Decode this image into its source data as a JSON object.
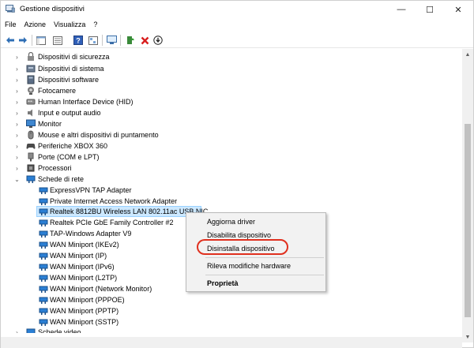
{
  "window": {
    "title": "Gestione dispositivi",
    "minimize_glyph": "—",
    "maximize_glyph": "☐",
    "close_glyph": "✕"
  },
  "menu": [
    "File",
    "Azione",
    "Visualizza",
    "?"
  ],
  "toolbar": {
    "icons": [
      "back-icon",
      "forward-icon",
      "show-hide-tree-icon",
      "properties-icon",
      "help-icon",
      "expand-icon",
      "monitor-scan-icon",
      "update-driver-icon",
      "uninstall-icon",
      "download-icon"
    ]
  },
  "tree": {
    "categories_before": [
      {
        "label": "Dispositivi di sicurezza",
        "icon": "security-icon"
      },
      {
        "label": "Dispositivi di sistema",
        "icon": "system-icon"
      },
      {
        "label": "Dispositivi software",
        "icon": "software-icon"
      },
      {
        "label": "Fotocamere",
        "icon": "camera-icon"
      },
      {
        "label": "Human Interface Device (HID)",
        "icon": "hid-icon"
      },
      {
        "label": "Input e output audio",
        "icon": "audio-icon"
      },
      {
        "label": "Monitor",
        "icon": "monitor-icon"
      },
      {
        "label": "Mouse e altri dispositivi di puntamento",
        "icon": "mouse-icon"
      },
      {
        "label": "Periferiche XBOX 360",
        "icon": "gamepad-icon"
      },
      {
        "label": "Porte (COM e LPT)",
        "icon": "port-icon"
      },
      {
        "label": "Processori",
        "icon": "cpu-icon"
      }
    ],
    "network_category": {
      "label": "Schede di rete",
      "icon": "network-icon"
    },
    "network_children": [
      "ExpressVPN TAP Adapter",
      "Private Internet Access Network Adapter",
      "Realtek 8812BU Wireless LAN 802.11ac USB NIC",
      "Realtek PCIe GbE Family Controller #2",
      "TAP-Windows Adapter V9",
      "WAN Miniport (IKEv2)",
      "WAN Miniport (IP)",
      "WAN Miniport (IPv6)",
      "WAN Miniport (L2TP)",
      "WAN Miniport (Network Monitor)",
      "WAN Miniport (PPPOE)",
      "WAN Miniport (PPTP)",
      "WAN Miniport (SSTP)"
    ],
    "selected": "Realtek 8812BU Wireless LAN 802.11ac USB NIC",
    "category_after": {
      "label": "Schede video",
      "icon": "display-adapter-icon"
    }
  },
  "context_menu": {
    "items": [
      {
        "label": "Aggiorna driver",
        "bold": false
      },
      {
        "label": "Disabilita dispositivo",
        "bold": false
      },
      {
        "label": "Disinstalla dispositivo",
        "bold": false,
        "highlighted": true
      },
      {
        "label": "Rileva modifiche hardware",
        "bold": false
      },
      {
        "label": "Proprietà",
        "bold": true
      }
    ]
  },
  "colors": {
    "selection_bg": "#cce8ff",
    "highlight_ring": "#e0301e",
    "network_icon": "#2b7fd4"
  }
}
